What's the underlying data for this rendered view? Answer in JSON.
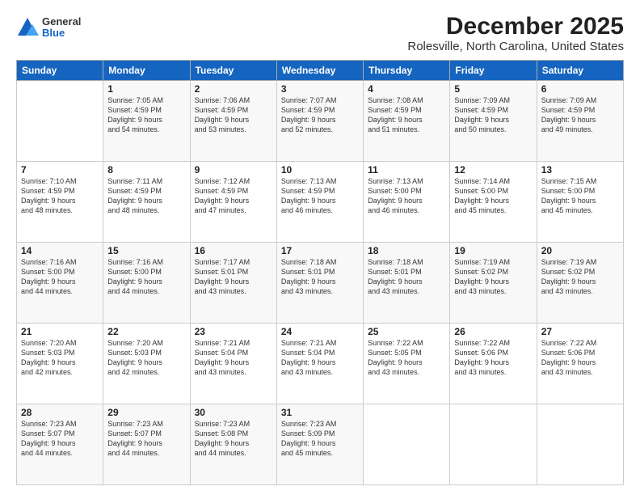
{
  "logo": {
    "general": "General",
    "blue": "Blue"
  },
  "title": "December 2025",
  "subtitle": "Rolesville, North Carolina, United States",
  "days_of_week": [
    "Sunday",
    "Monday",
    "Tuesday",
    "Wednesday",
    "Thursday",
    "Friday",
    "Saturday"
  ],
  "weeks": [
    [
      {
        "day": "",
        "info": ""
      },
      {
        "day": "1",
        "info": "Sunrise: 7:05 AM\nSunset: 4:59 PM\nDaylight: 9 hours\nand 54 minutes."
      },
      {
        "day": "2",
        "info": "Sunrise: 7:06 AM\nSunset: 4:59 PM\nDaylight: 9 hours\nand 53 minutes."
      },
      {
        "day": "3",
        "info": "Sunrise: 7:07 AM\nSunset: 4:59 PM\nDaylight: 9 hours\nand 52 minutes."
      },
      {
        "day": "4",
        "info": "Sunrise: 7:08 AM\nSunset: 4:59 PM\nDaylight: 9 hours\nand 51 minutes."
      },
      {
        "day": "5",
        "info": "Sunrise: 7:09 AM\nSunset: 4:59 PM\nDaylight: 9 hours\nand 50 minutes."
      },
      {
        "day": "6",
        "info": "Sunrise: 7:09 AM\nSunset: 4:59 PM\nDaylight: 9 hours\nand 49 minutes."
      }
    ],
    [
      {
        "day": "7",
        "info": "Sunrise: 7:10 AM\nSunset: 4:59 PM\nDaylight: 9 hours\nand 48 minutes."
      },
      {
        "day": "8",
        "info": "Sunrise: 7:11 AM\nSunset: 4:59 PM\nDaylight: 9 hours\nand 48 minutes."
      },
      {
        "day": "9",
        "info": "Sunrise: 7:12 AM\nSunset: 4:59 PM\nDaylight: 9 hours\nand 47 minutes."
      },
      {
        "day": "10",
        "info": "Sunrise: 7:13 AM\nSunset: 4:59 PM\nDaylight: 9 hours\nand 46 minutes."
      },
      {
        "day": "11",
        "info": "Sunrise: 7:13 AM\nSunset: 5:00 PM\nDaylight: 9 hours\nand 46 minutes."
      },
      {
        "day": "12",
        "info": "Sunrise: 7:14 AM\nSunset: 5:00 PM\nDaylight: 9 hours\nand 45 minutes."
      },
      {
        "day": "13",
        "info": "Sunrise: 7:15 AM\nSunset: 5:00 PM\nDaylight: 9 hours\nand 45 minutes."
      }
    ],
    [
      {
        "day": "14",
        "info": "Sunrise: 7:16 AM\nSunset: 5:00 PM\nDaylight: 9 hours\nand 44 minutes."
      },
      {
        "day": "15",
        "info": "Sunrise: 7:16 AM\nSunset: 5:00 PM\nDaylight: 9 hours\nand 44 minutes."
      },
      {
        "day": "16",
        "info": "Sunrise: 7:17 AM\nSunset: 5:01 PM\nDaylight: 9 hours\nand 43 minutes."
      },
      {
        "day": "17",
        "info": "Sunrise: 7:18 AM\nSunset: 5:01 PM\nDaylight: 9 hours\nand 43 minutes."
      },
      {
        "day": "18",
        "info": "Sunrise: 7:18 AM\nSunset: 5:01 PM\nDaylight: 9 hours\nand 43 minutes."
      },
      {
        "day": "19",
        "info": "Sunrise: 7:19 AM\nSunset: 5:02 PM\nDaylight: 9 hours\nand 43 minutes."
      },
      {
        "day": "20",
        "info": "Sunrise: 7:19 AM\nSunset: 5:02 PM\nDaylight: 9 hours\nand 43 minutes."
      }
    ],
    [
      {
        "day": "21",
        "info": "Sunrise: 7:20 AM\nSunset: 5:03 PM\nDaylight: 9 hours\nand 42 minutes."
      },
      {
        "day": "22",
        "info": "Sunrise: 7:20 AM\nSunset: 5:03 PM\nDaylight: 9 hours\nand 42 minutes."
      },
      {
        "day": "23",
        "info": "Sunrise: 7:21 AM\nSunset: 5:04 PM\nDaylight: 9 hours\nand 43 minutes."
      },
      {
        "day": "24",
        "info": "Sunrise: 7:21 AM\nSunset: 5:04 PM\nDaylight: 9 hours\nand 43 minutes."
      },
      {
        "day": "25",
        "info": "Sunrise: 7:22 AM\nSunset: 5:05 PM\nDaylight: 9 hours\nand 43 minutes."
      },
      {
        "day": "26",
        "info": "Sunrise: 7:22 AM\nSunset: 5:06 PM\nDaylight: 9 hours\nand 43 minutes."
      },
      {
        "day": "27",
        "info": "Sunrise: 7:22 AM\nSunset: 5:06 PM\nDaylight: 9 hours\nand 43 minutes."
      }
    ],
    [
      {
        "day": "28",
        "info": "Sunrise: 7:23 AM\nSunset: 5:07 PM\nDaylight: 9 hours\nand 44 minutes."
      },
      {
        "day": "29",
        "info": "Sunrise: 7:23 AM\nSunset: 5:07 PM\nDaylight: 9 hours\nand 44 minutes."
      },
      {
        "day": "30",
        "info": "Sunrise: 7:23 AM\nSunset: 5:08 PM\nDaylight: 9 hours\nand 44 minutes."
      },
      {
        "day": "31",
        "info": "Sunrise: 7:23 AM\nSunset: 5:09 PM\nDaylight: 9 hours\nand 45 minutes."
      },
      {
        "day": "",
        "info": ""
      },
      {
        "day": "",
        "info": ""
      },
      {
        "day": "",
        "info": ""
      }
    ]
  ]
}
